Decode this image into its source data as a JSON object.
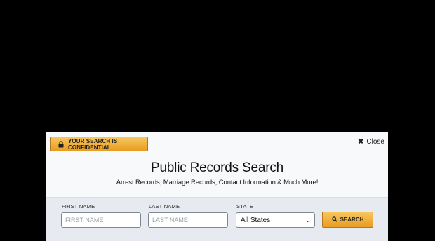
{
  "banner": {
    "confidential_text": "YOUR SEARCH IS CONFIDENTIAL",
    "close_label": "Close"
  },
  "heading": {
    "title": "Public Records Search",
    "subtitle": "Arrest Records, Marriage Records, Contact Information & Much More!"
  },
  "form": {
    "first_name": {
      "label": "FIRST NAME",
      "placeholder": "FIRST NAME",
      "value": ""
    },
    "last_name": {
      "label": "LAST NAME",
      "placeholder": "LAST NAME",
      "value": ""
    },
    "state": {
      "label": "STATE",
      "selected": "All States"
    },
    "search_label": "SEARCH"
  },
  "icons": {
    "lock": "lock-icon",
    "close": "close-icon",
    "chevron": "chevron-down-icon",
    "search": "search-icon"
  },
  "colors": {
    "background": "#000000",
    "accent": "#f0b03e",
    "panel": "#f8f9fb",
    "form_band": "#e7ebf1"
  }
}
